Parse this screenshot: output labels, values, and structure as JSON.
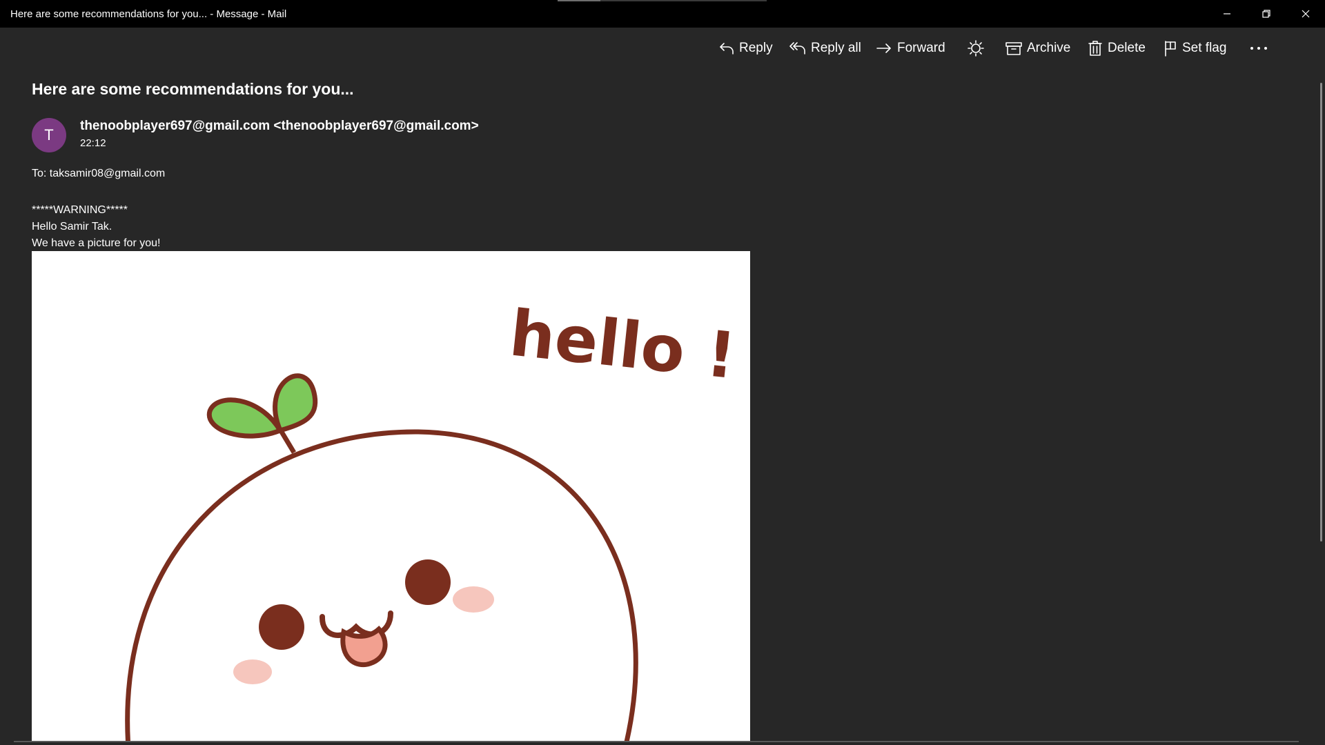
{
  "window": {
    "title": "Here are some recommendations for you... - Message - Mail"
  },
  "toolbar": {
    "reply": "Reply",
    "reply_all": "Reply all",
    "forward": "Forward",
    "archive": "Archive",
    "delete": "Delete",
    "set_flag": "Set flag"
  },
  "message": {
    "subject": "Here are some recommendations for you...",
    "avatar_initial": "T",
    "avatar_color": "#7b3a82",
    "sender": "thenoobplayer697@gmail.com <thenoobplayer697@gmail.com>",
    "time": "22:12",
    "to": "To: taksamir08@gmail.com",
    "body": [
      "*****WARNING*****",
      "Hello Samir Tak.",
      "We have a picture for you!"
    ]
  },
  "picture": {
    "text": "hello !",
    "colors": {
      "outline": "#7a2e1e",
      "leaf": "#7dc85a",
      "blush": "#f6c6bd",
      "tongue": "#f2a090"
    }
  }
}
